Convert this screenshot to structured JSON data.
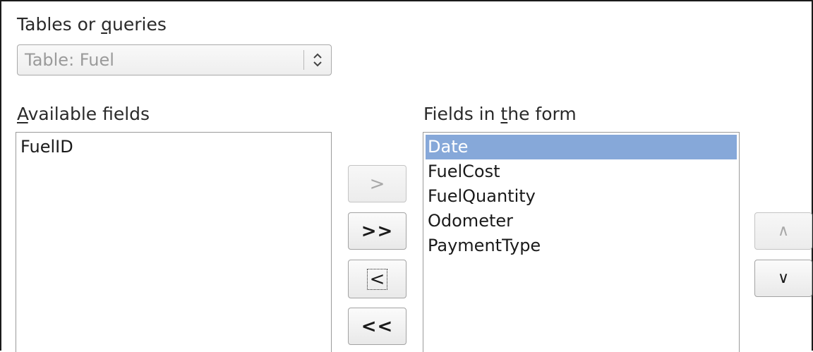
{
  "tables_or_queries": {
    "label_prefix": "Tables or ",
    "label_mnemonic": "q",
    "label_suffix": "ueries",
    "selected_value": "Table: Fuel"
  },
  "available_fields": {
    "label_mnemonic": "A",
    "label_suffix": "vailable fields",
    "items": [
      "FuelID"
    ]
  },
  "form_fields": {
    "label_prefix": "Fields in ",
    "label_mnemonic": "t",
    "label_suffix": "he form",
    "items": [
      "Date",
      "FuelCost",
      "FuelQuantity",
      "Odometer",
      "PaymentType"
    ],
    "selected_index": 0
  },
  "transfer_buttons": {
    "add_one": ">",
    "add_all": ">>",
    "remove_one": "<",
    "remove_all": "<<"
  },
  "order_buttons": {
    "move_up": "∧",
    "move_down": "∨"
  },
  "colors": {
    "selection": "#86a8d9",
    "disabled_text": "#a8a8a8"
  },
  "icons": {
    "combo_arrow": "updown-chevron-icon"
  }
}
